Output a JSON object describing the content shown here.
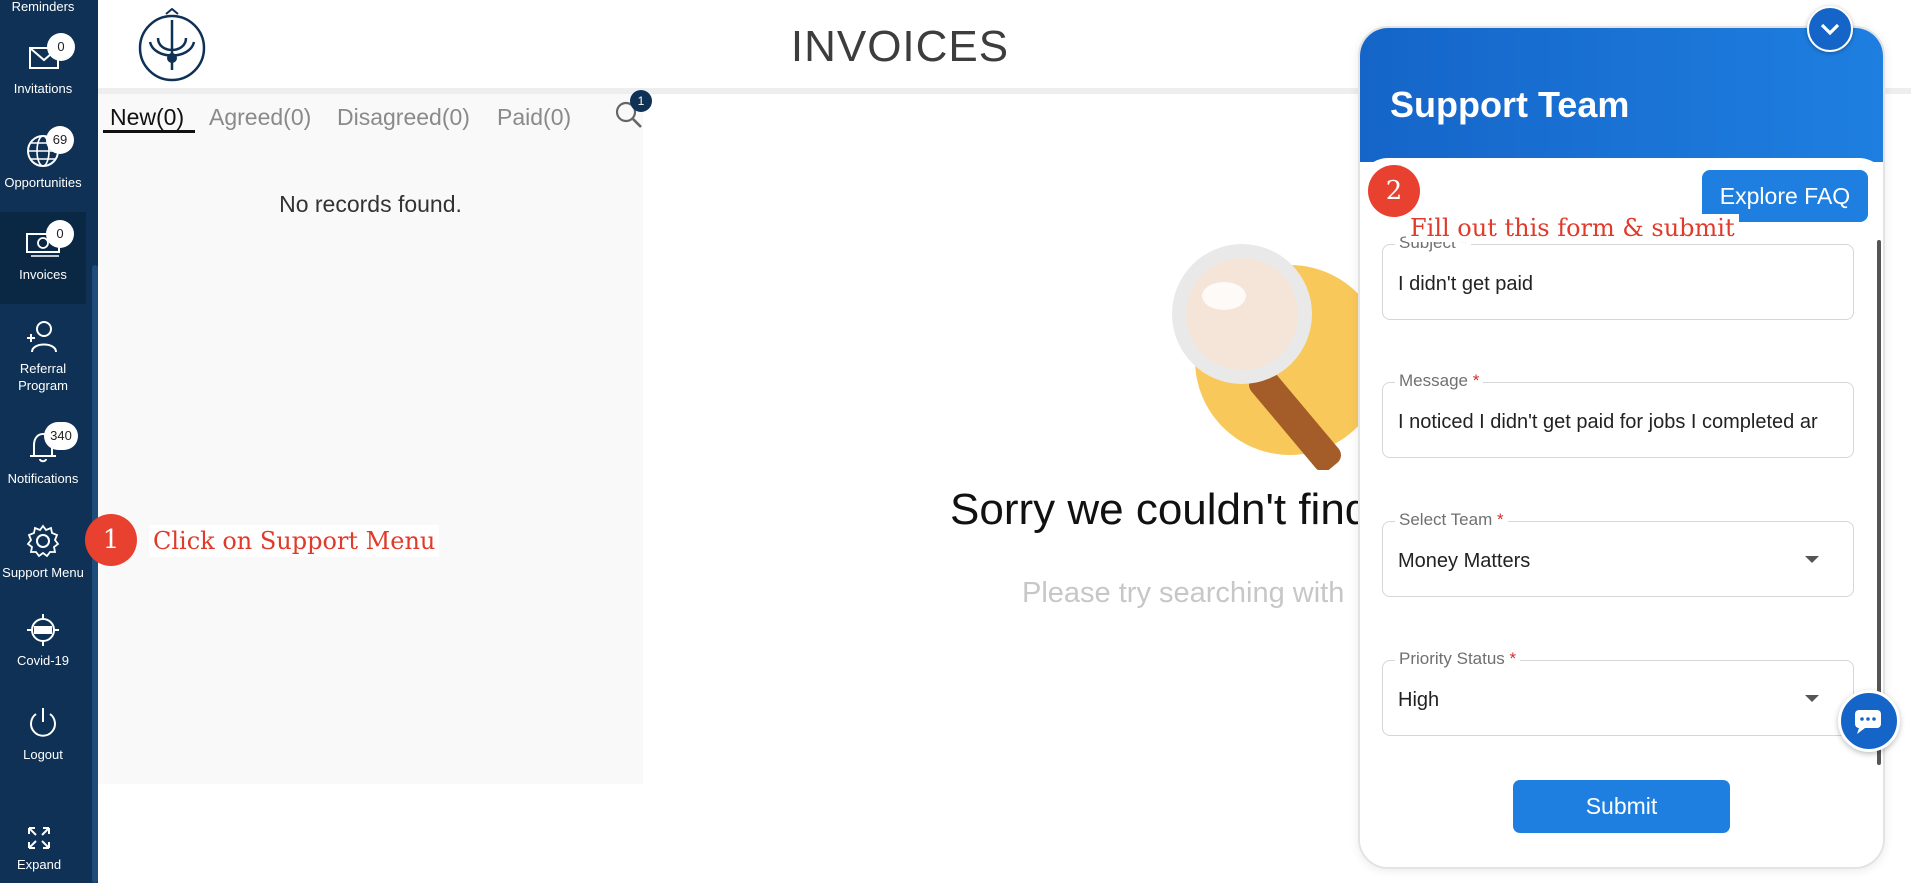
{
  "sidebar": {
    "items": [
      {
        "label": "Reminders"
      },
      {
        "label": "Invitations",
        "badge": "0"
      },
      {
        "label": "Opportunities",
        "badge": "69"
      },
      {
        "label": "Invoices",
        "badge": "0"
      },
      {
        "label_line1": "Referral",
        "label_line2": "Program"
      },
      {
        "label": "Notifications",
        "badge": "340"
      },
      {
        "label": "Support Menu"
      },
      {
        "label": "Covid-19"
      },
      {
        "label": "Logout"
      },
      {
        "label": "Expand"
      }
    ]
  },
  "header": {
    "title": "INVOICES"
  },
  "tabs": [
    {
      "label": "New(0)",
      "active": true
    },
    {
      "label": "Agreed(0)"
    },
    {
      "label": "Disagreed(0)"
    },
    {
      "label": "Paid(0)"
    }
  ],
  "search": {
    "badge": "1"
  },
  "list": {
    "empty_text": "No records found."
  },
  "empty_state": {
    "title": "Sorry we couldn't find",
    "subtitle": "Please try searching with"
  },
  "annotations": [
    {
      "number": "1",
      "text": "Click on Support Menu"
    },
    {
      "number": "2",
      "text": "Fill out this form & submit"
    }
  ],
  "widget": {
    "title": "Support Team",
    "faq_label": "Explore FAQ",
    "fields": [
      {
        "label": "Subject",
        "required": "*",
        "value": "I didn't get paid"
      },
      {
        "label": "Message",
        "required": "*",
        "value": "I noticed I didn't get paid for jobs I completed ar"
      },
      {
        "label": "Select Team",
        "required": "*",
        "value": "Money Matters"
      },
      {
        "label": "Priority Status",
        "required": "*",
        "value": "High"
      }
    ],
    "submit_label": "Submit"
  },
  "colors": {
    "sidebar": "#0e3155",
    "accent": "#1e7fe0",
    "annotation": "#e9412f"
  }
}
